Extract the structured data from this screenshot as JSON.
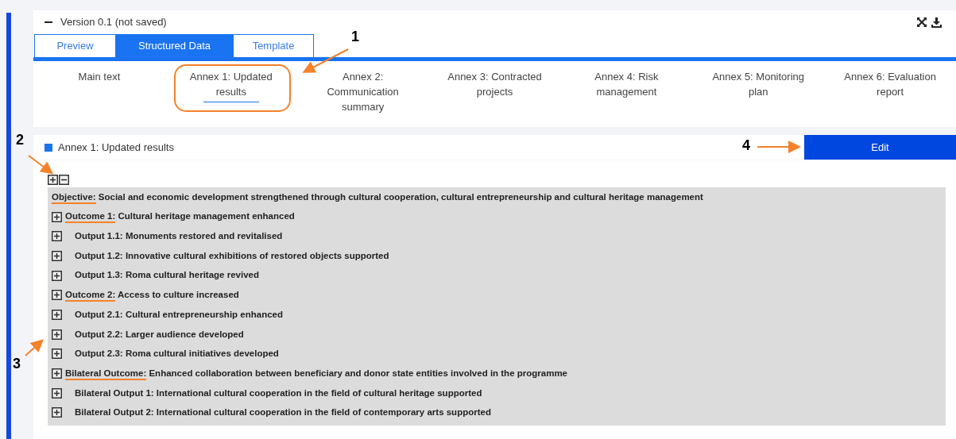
{
  "version_header": {
    "title": "Version 0.1 (not saved)",
    "collapsed": false
  },
  "view_tabs": [
    {
      "label": "Preview",
      "selected": false
    },
    {
      "label": "Structured Data",
      "selected": true
    },
    {
      "label": "Template",
      "selected": false
    }
  ],
  "annex_tabs": [
    {
      "label": "Main text",
      "selected": false
    },
    {
      "label": "Annex 1: Updated results",
      "selected": true
    },
    {
      "label": "Annex 2: Communication summary",
      "selected": false
    },
    {
      "label": "Annex 3: Contracted projects",
      "selected": false
    },
    {
      "label": "Annex 4: Risk management",
      "selected": false
    },
    {
      "label": "Annex 5: Monitoring plan",
      "selected": false
    },
    {
      "label": "Annex 6: Evaluation report",
      "selected": false
    }
  ],
  "section": {
    "title": "Annex 1: Updated results",
    "button": "Edit"
  },
  "tree": [
    {
      "label": "Objective:",
      "text": "Social and economic development strengthened through cultural cooperation, cultural entrepreneurship and cultural heritage management",
      "underlined": true,
      "has_toggle": false
    },
    {
      "label": "Outcome 1:",
      "text": "Cultural heritage management enhanced",
      "underlined": true,
      "has_toggle": true,
      "children": [
        {
          "text": "Output 1.1: Monuments restored and revitalised",
          "has_toggle": true
        },
        {
          "text": "Output 1.2: Innovative cultural exhibitions of restored objects supported",
          "has_toggle": true
        },
        {
          "text": "Output 1.3: Roma cultural heritage revived",
          "has_toggle": true
        }
      ]
    },
    {
      "label": "Outcome 2:",
      "text": "Access to culture increased",
      "underlined": true,
      "has_toggle": true,
      "children": [
        {
          "text": "Output 2.1: Cultural entrepreneurship enhanced",
          "has_toggle": true
        },
        {
          "text": "Output 2.2: Larger audience developed",
          "has_toggle": true
        },
        {
          "text": "Output 2.3: Roma cultural initiatives developed",
          "has_toggle": true
        }
      ]
    },
    {
      "label": "Bilateral Outcome:",
      "text": "Enhanced collaboration between beneficiary and donor state entities involved in the programme",
      "underlined": true,
      "has_toggle": true,
      "children": [
        {
          "text": "Bilateral Output 1: International cultural cooperation in the field of cultural heritage supported",
          "has_toggle": true
        },
        {
          "text": "Bilateral Output 2: International cultural cooperation in the field of contemporary arts supported",
          "has_toggle": true
        }
      ]
    }
  ],
  "callouts": [
    {
      "label": "1"
    },
    {
      "label": "2"
    },
    {
      "label": "3"
    },
    {
      "label": "4"
    }
  ]
}
